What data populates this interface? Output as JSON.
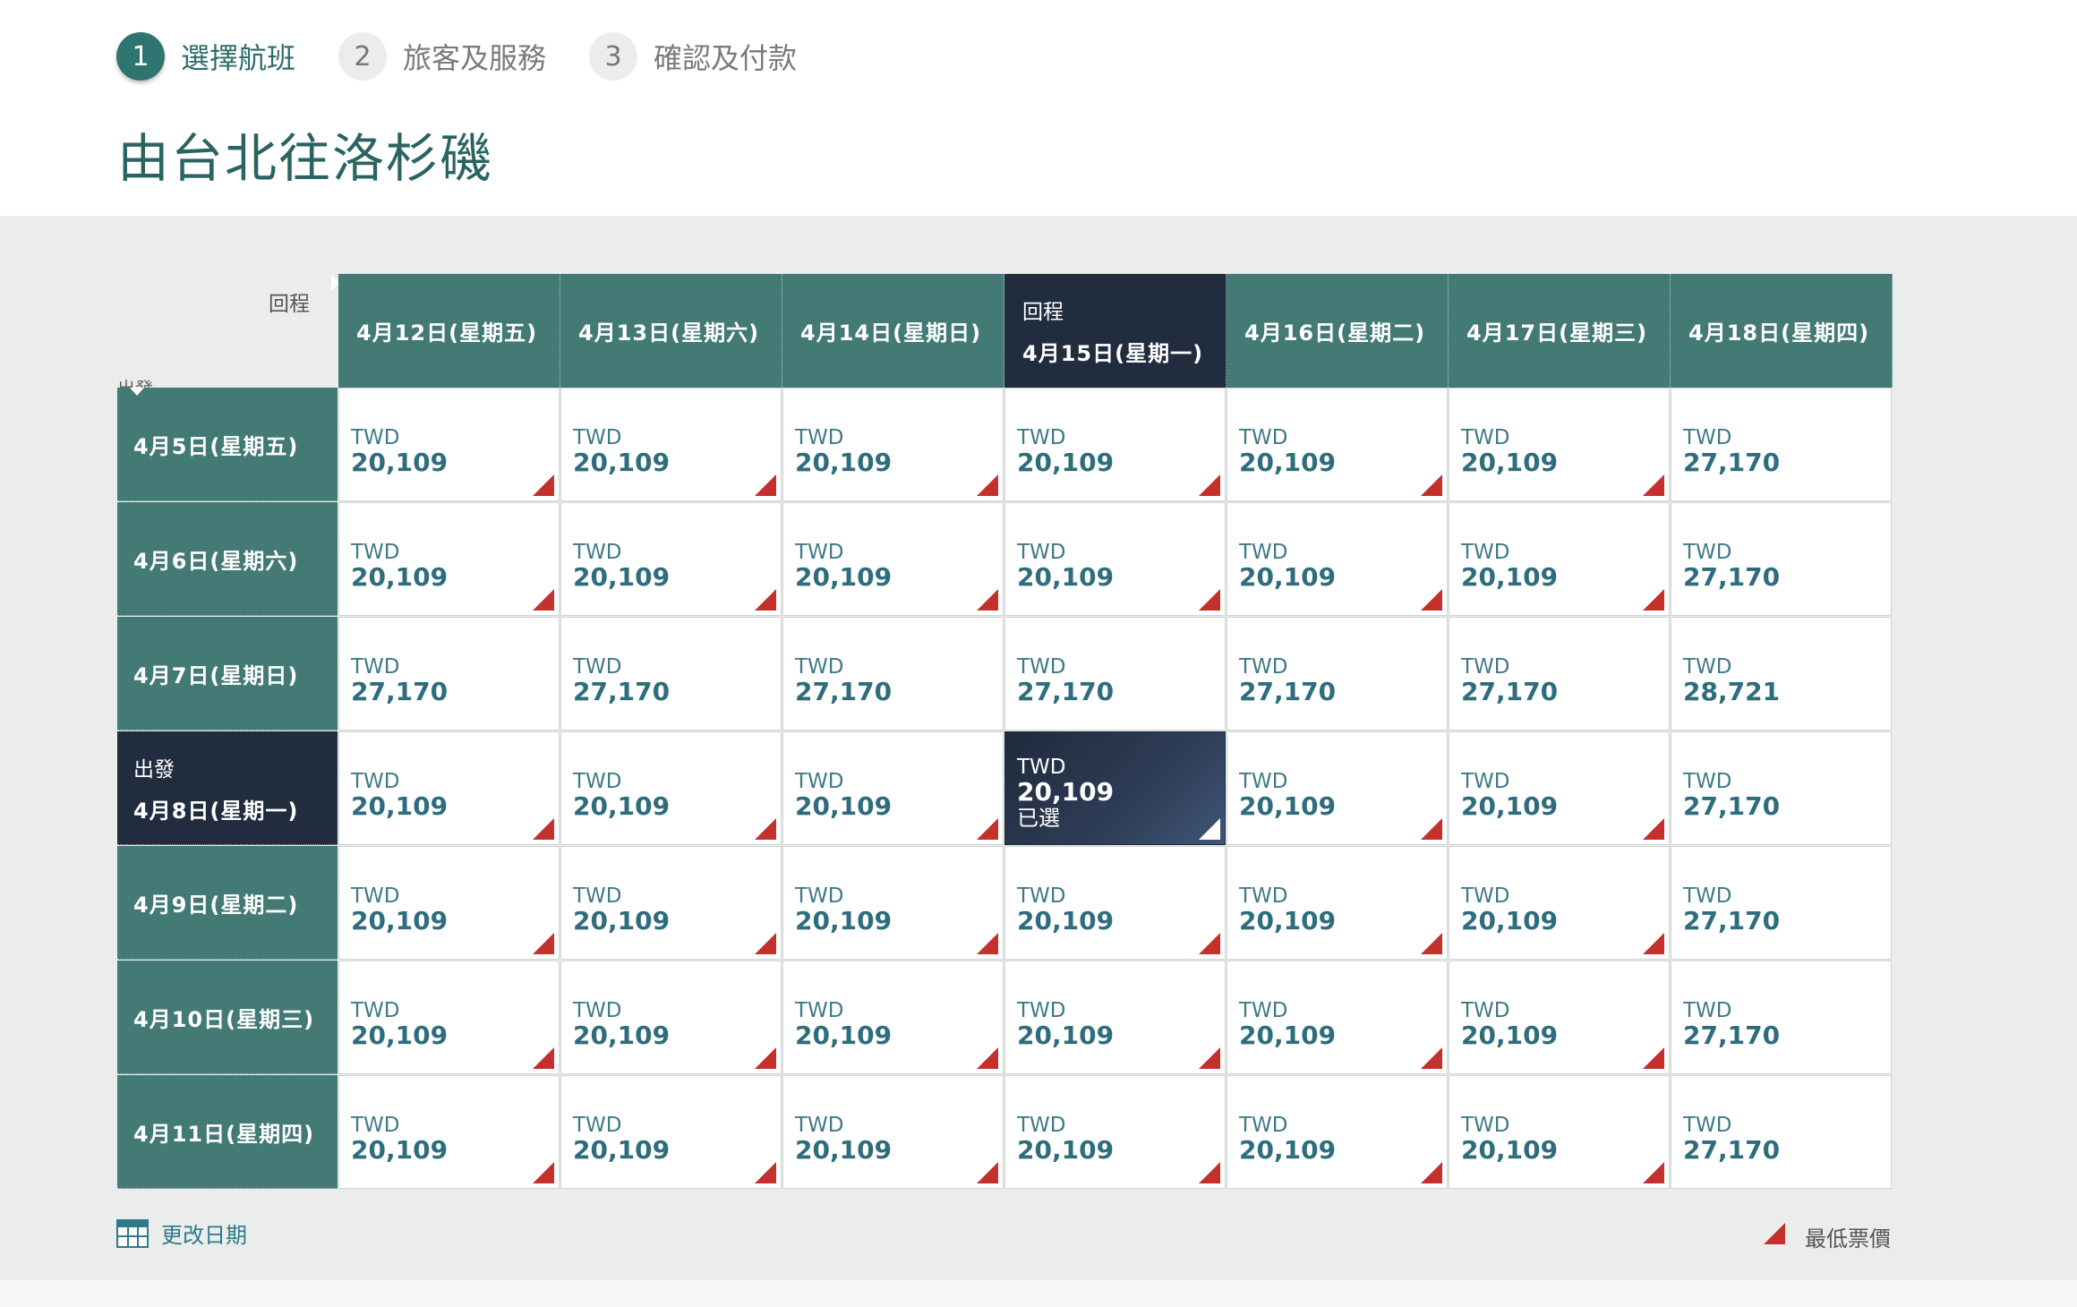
{
  "steps": [
    {
      "num": "1",
      "label": "選擇航班",
      "active": true
    },
    {
      "num": "2",
      "label": "旅客及服務",
      "active": false
    },
    {
      "num": "3",
      "label": "確認及付款",
      "active": false
    }
  ],
  "page_title": "由台北往洛杉磯",
  "corner": {
    "return_label": "回程",
    "depart_label": "出發"
  },
  "return_dates": [
    "4月12日(星期五)",
    "4月13日(星期六)",
    "4月14日(星期日)",
    "4月15日(星期一)",
    "4月16日(星期二)",
    "4月17日(星期三)",
    "4月18日(星期四)"
  ],
  "depart_dates": [
    "4月5日(星期五)",
    "4月6日(星期六)",
    "4月7日(星期日)",
    "4月8日(星期一)",
    "4月9日(星期二)",
    "4月10日(星期三)",
    "4月11日(星期四)"
  ],
  "selected": {
    "row": 3,
    "col": 3,
    "label": "已選"
  },
  "currency": "TWD",
  "prices": [
    [
      "20,109",
      "20,109",
      "20,109",
      "20,109",
      "20,109",
      "20,109",
      "27,170"
    ],
    [
      "20,109",
      "20,109",
      "20,109",
      "20,109",
      "20,109",
      "20,109",
      "27,170"
    ],
    [
      "27,170",
      "27,170",
      "27,170",
      "27,170",
      "27,170",
      "27,170",
      "28,721"
    ],
    [
      "20,109",
      "20,109",
      "20,109",
      "20,109",
      "20,109",
      "20,109",
      "27,170"
    ],
    [
      "20,109",
      "20,109",
      "20,109",
      "20,109",
      "20,109",
      "20,109",
      "27,170"
    ],
    [
      "20,109",
      "20,109",
      "20,109",
      "20,109",
      "20,109",
      "20,109",
      "27,170"
    ],
    [
      "20,109",
      "20,109",
      "20,109",
      "20,109",
      "20,109",
      "20,109",
      "27,170"
    ]
  ],
  "lowest": [
    [
      true,
      true,
      true,
      true,
      true,
      true,
      false
    ],
    [
      true,
      true,
      true,
      true,
      true,
      true,
      false
    ],
    [
      false,
      false,
      false,
      false,
      false,
      false,
      false
    ],
    [
      true,
      true,
      true,
      true,
      true,
      true,
      false
    ],
    [
      true,
      true,
      true,
      true,
      true,
      true,
      false
    ],
    [
      true,
      true,
      true,
      true,
      true,
      true,
      false
    ],
    [
      true,
      true,
      true,
      true,
      true,
      true,
      false
    ]
  ],
  "footer": {
    "change_date_label": "更改日期",
    "legend_label": "最低票價"
  },
  "colors": {
    "header_teal": "#437a76",
    "selected_navy": "#222c3f",
    "lowest_marker": "#c4302b",
    "price_text": "#2e6d7d"
  }
}
